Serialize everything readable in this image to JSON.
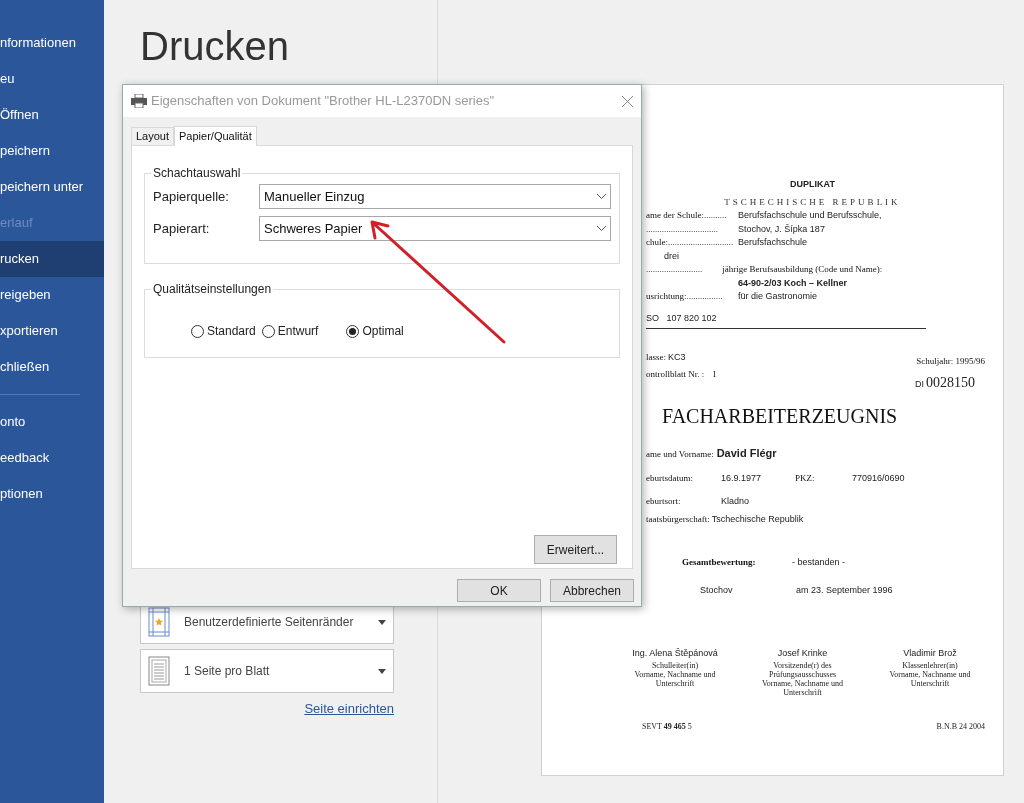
{
  "sidebar": {
    "items": [
      {
        "label": "nformationen",
        "selected": false,
        "disabled": false
      },
      {
        "label": "eu",
        "selected": false,
        "disabled": false
      },
      {
        "label": "Öffnen",
        "selected": false,
        "disabled": false
      },
      {
        "label": "peichern",
        "selected": false,
        "disabled": false
      },
      {
        "label": "peichern unter",
        "selected": false,
        "disabled": false
      },
      {
        "label": "erlauf",
        "selected": false,
        "disabled": true
      },
      {
        "label": "rucken",
        "selected": true,
        "disabled": false
      },
      {
        "label": "reigeben",
        "selected": false,
        "disabled": false
      },
      {
        "label": "xportieren",
        "selected": false,
        "disabled": false
      },
      {
        "label": "chließen",
        "selected": false,
        "disabled": false
      }
    ],
    "bottom_items": [
      {
        "label": "onto",
        "selected": false,
        "disabled": false
      },
      {
        "label": "eedback",
        "selected": false,
        "disabled": false
      },
      {
        "label": "ptionen",
        "selected": false,
        "disabled": false
      }
    ]
  },
  "page_title": "Drucken",
  "settings": [
    {
      "kind": "margins",
      "label": "Benutzerdefinierte Seitenränder"
    },
    {
      "kind": "pages",
      "label": "1 Seite pro Blatt"
    }
  ],
  "setup_link": "Seite einrichten",
  "dialog": {
    "title": "Eigenschaften von Dokument \"Brother HL-L2370DN series\"",
    "tabs": [
      {
        "label": "Layout",
        "selected": false
      },
      {
        "label": "Papier/Qualität",
        "selected": true
      }
    ],
    "tray_group": {
      "title": "Schachtauswahl",
      "fields": [
        {
          "label": "Papierquelle:",
          "value": "Manueller Einzug"
        },
        {
          "label": "Papierart:",
          "value": "Schweres Papier"
        }
      ]
    },
    "quality_group": {
      "title": "Qualitätseinstellungen",
      "options": [
        {
          "label": "Standard",
          "selected": false
        },
        {
          "label": "Entwurf",
          "selected": false
        },
        {
          "label": "Optimal",
          "selected": true
        }
      ]
    },
    "advanced_button": "Erweitert...",
    "buttons": [
      "OK",
      "Abbrechen"
    ]
  },
  "document": {
    "header": "DUPLIKAT",
    "country": "TSCHECHISCHE REPUBLIK",
    "rows": [
      {
        "label": "ame der Schule:..........",
        "value": "Berufsfachschule und Berufsschule,"
      },
      {
        "dots": "................................",
        "value": "Stochov, J. Šípka 187"
      },
      {
        "label": "chule:.............................",
        "value": "Berufsfachschule"
      }
    ],
    "years": "drei",
    "training_label": "jährige Berufsausbildung (Code und Name):",
    "training_dots": ".........................",
    "training_value": "64-90-2/03 Koch – Kellner",
    "focus_label": "usrichtung:................",
    "focus_value": "für die Gastronomie",
    "code": "SO   107 820 102",
    "class_label": "lasse:",
    "class_value": "KC3",
    "year": "Schuljahr: 1995/96",
    "control_label": "ontrollblatt Nr. :",
    "control_value": "1",
    "serial_prefix": "DI",
    "serial": "0028150",
    "heading": "FACHARBEITERZEUGNIS",
    "name_label": "ame und Vorname:",
    "name_value": "David Flégr",
    "birth_label": "eburtsdatum:",
    "birth_value": "16.9.1977",
    "pkz_label": "PKZ:",
    "pkz_value": "770916/0690",
    "place_label": "eburtsort:",
    "place_value": "Kladno",
    "citizen_label": "taatsbürgerschaft:",
    "citizen_value": "Tschechische Republik",
    "result_label": "Gesamtbewertung:",
    "result_value": "- bestanden -",
    "city": "Stochov",
    "date": "am 23. September 1996",
    "signatures": [
      {
        "name": "Ing. Alena Štěpánová",
        "role": "Schulleiter(in)",
        "note": "Vorname, Nachname und Unterschrift"
      },
      {
        "name": "Josef Krinke",
        "role": "Vorsitzende(r) des Prüfungsausschusses",
        "note": "Vorname, Nachname und Unterschrift"
      },
      {
        "name": "Vladimir Brož",
        "role": "Klassenlehrer(in)",
        "note": "Vorname, Nachname und Unterschrift"
      }
    ],
    "footer_left": "SEVT **49 465** 5",
    "footer_right": "B.N.B 24 2004"
  }
}
